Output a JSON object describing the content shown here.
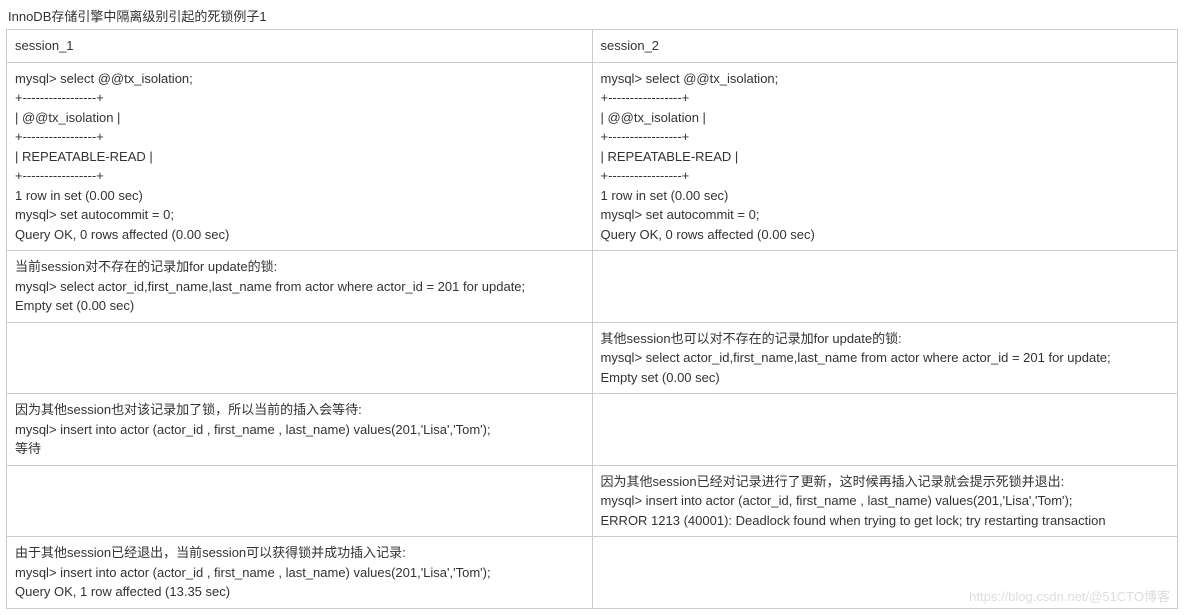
{
  "title": "InnoDB存储引擎中隔离级别引起的死锁例子1",
  "headers": {
    "col1": "session_1",
    "col2": "session_2"
  },
  "rows": [
    {
      "c1": "mysql> select @@tx_isolation;\n+-----------------+\n| @@tx_isolation  |\n+-----------------+\n| REPEATABLE-READ |\n+-----------------+\n1 row in set (0.00 sec)\nmysql> set autocommit = 0;\nQuery OK, 0 rows affected (0.00 sec)",
      "c2": "mysql> select @@tx_isolation;\n+-----------------+\n| @@tx_isolation  |\n+-----------------+\n| REPEATABLE-READ |\n+-----------------+\n1 row in set (0.00 sec)\nmysql> set autocommit = 0;\nQuery OK, 0 rows affected (0.00 sec)"
    },
    {
      "c1": "当前session对不存在的记录加for update的锁:\nmysql> select actor_id,first_name,last_name from actor where actor_id = 201 for update;\nEmpty set (0.00 sec)",
      "c2": ""
    },
    {
      "c1": "",
      "c2": "其他session也可以对不存在的记录加for update的锁:\nmysql> select actor_id,first_name,last_name from actor where actor_id = 201 for update;\nEmpty set (0.00 sec)"
    },
    {
      "c1": "因为其他session也对该记录加了锁，所以当前的插入会等待:\nmysql> insert into actor (actor_id , first_name , last_name) values(201,'Lisa','Tom');\n等待",
      "c2": ""
    },
    {
      "c1": "",
      "c2": "因为其他session已经对记录进行了更新，这时候再插入记录就会提示死锁并退出:\nmysql> insert into actor (actor_id, first_name , last_name) values(201,'Lisa','Tom');\nERROR 1213 (40001): Deadlock found when trying to get lock; try restarting transaction"
    },
    {
      "c1": "由于其他session已经退出，当前session可以获得锁并成功插入记录:\nmysql> insert into actor (actor_id , first_name , last_name) values(201,'Lisa','Tom');\nQuery OK, 1 row affected (13.35 sec)",
      "c2": ""
    }
  ],
  "watermark": "https://blog.csdn.net/@51CTO博客"
}
